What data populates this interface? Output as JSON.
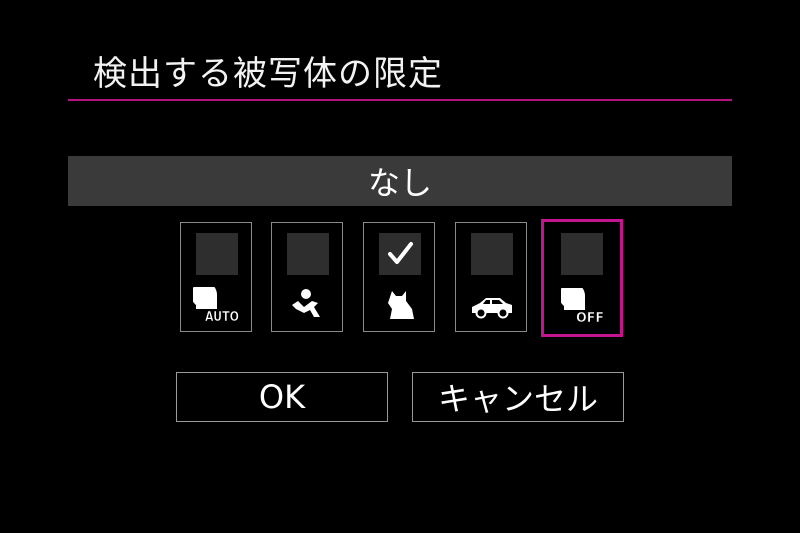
{
  "screen": {
    "title": "検出する被写体の限定",
    "accent_color": "#c4148e"
  },
  "selection": {
    "label": "なし"
  },
  "options": [
    {
      "id": "auto",
      "icon": "subject-auto-icon",
      "icon_text": "AUTO",
      "checked": false,
      "selected": false
    },
    {
      "id": "people",
      "icon": "person-icon",
      "checked": false,
      "selected": false
    },
    {
      "id": "animals",
      "icon": "animal-icon",
      "checked": true,
      "selected": false
    },
    {
      "id": "vehicles",
      "icon": "vehicle-icon",
      "checked": false,
      "selected": false
    },
    {
      "id": "off",
      "icon": "subject-off-icon",
      "icon_text": "OFF",
      "checked": false,
      "selected": true
    }
  ],
  "buttons": {
    "ok_label": "OK",
    "cancel_label": "キャンセル"
  }
}
